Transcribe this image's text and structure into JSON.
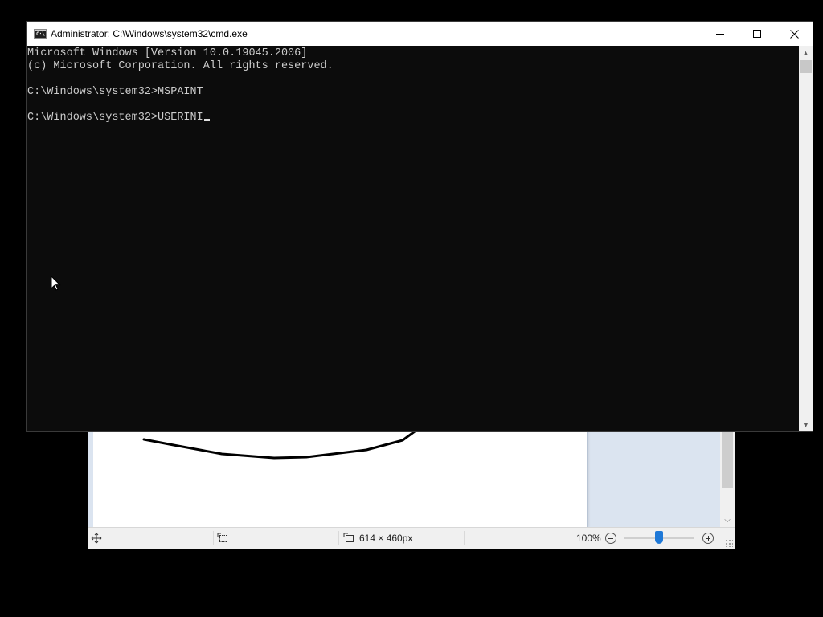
{
  "paint": {
    "status": {
      "move_icon": "move-icon",
      "selection_icon": "selection-size-icon",
      "canvas_size_icon": "canvas-size-icon",
      "canvas_size": "614 × 460px",
      "zoom_level": "100%",
      "zoom_slider_percent": 50
    }
  },
  "cmd": {
    "title": "Administrator: C:\\Windows\\system32\\cmd.exe",
    "icon_text": "C:\\",
    "lines": [
      "Microsoft Windows [Version 10.0.19045.2006]",
      "(c) Microsoft Corporation. All rights reserved.",
      "",
      "C:\\Windows\\system32>MSPAINT",
      "",
      "C:\\Windows\\system32>USERINI"
    ],
    "colors": {
      "background": "#0c0c0c",
      "text": "#cccccc"
    }
  }
}
